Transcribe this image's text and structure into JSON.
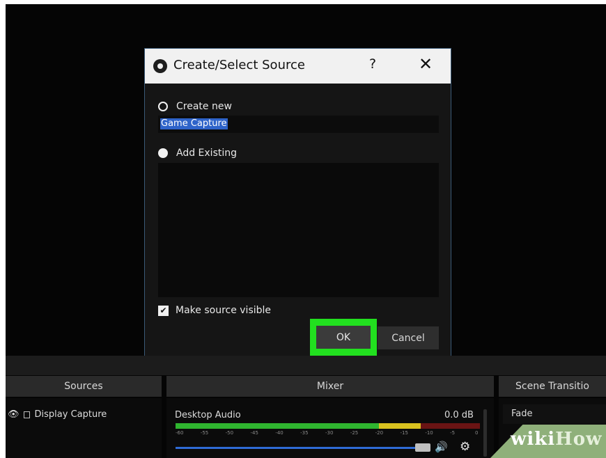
{
  "dialog": {
    "title": "Create/Select Source",
    "help_label": "?",
    "close_label": "✕",
    "create_new_label": "Create new",
    "name_value": "Game Capture",
    "add_existing_label": "Add Existing",
    "make_visible_label": "Make source visible",
    "make_visible_checked": true,
    "selected_option": "Add Existing",
    "ok_label": "OK",
    "cancel_label": "Cancel"
  },
  "panels": {
    "sources_header": "Sources",
    "mixer_header": "Mixer",
    "transitions_header": "Scene Transitio"
  },
  "sources": {
    "items": [
      {
        "label": "Display Capture"
      }
    ]
  },
  "mixer": {
    "channel_label": "Desktop Audio",
    "level": "0.0 dB",
    "ticks": [
      "-60",
      "-55",
      "-50",
      "-45",
      "-40",
      "-35",
      "-30",
      "-25",
      "-20",
      "-15",
      "-10",
      "-5",
      "0"
    ]
  },
  "transitions": {
    "selected": "Fade"
  },
  "watermark": {
    "part1": "wiki",
    "part2": "How"
  },
  "colors": {
    "highlight": "#22e01f",
    "selection": "#2e63c9",
    "slider": "#2f6bd6"
  }
}
